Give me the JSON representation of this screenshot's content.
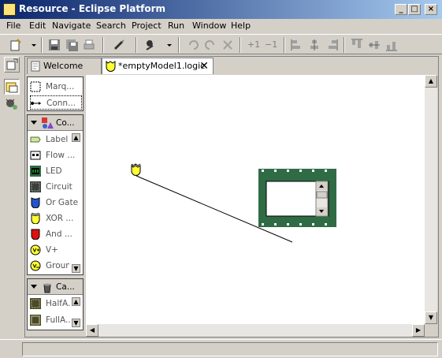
{
  "window": {
    "title": "Resource - Eclipse Platform"
  },
  "menu": [
    "File",
    "Edit",
    "Navigate",
    "Search",
    "Project",
    "Run",
    "Window",
    "Help"
  ],
  "toolbar": {
    "plus_one": "+1",
    "minus_one": "−1"
  },
  "tabs": [
    {
      "label": "Welcome"
    },
    {
      "label": "*emptyModel1.logic"
    }
  ],
  "palette": {
    "tools": [
      {
        "label": "Marq..."
      },
      {
        "label": "Conn..."
      }
    ],
    "components_header": "Co...",
    "components": [
      {
        "label": "Label",
        "icon": "label-icon"
      },
      {
        "label": "Flow ...",
        "icon": "flow-container-icon"
      },
      {
        "label": "LED",
        "icon": "led-icon"
      },
      {
        "label": "Circuit",
        "icon": "circuit-icon"
      },
      {
        "label": "Or Gate",
        "icon": "or-gate-icon"
      },
      {
        "label": "XOR ...",
        "icon": "xor-gate-icon"
      },
      {
        "label": "And ...",
        "icon": "and-gate-icon"
      },
      {
        "label": "V+",
        "icon": "vplus-icon"
      },
      {
        "label": "Ground",
        "icon": "ground-icon"
      }
    ],
    "canned_header": "Ca...",
    "canned": [
      {
        "label": "HalfA...",
        "icon": "half-adder-icon"
      },
      {
        "label": "FullA...",
        "icon": "full-adder-icon"
      }
    ]
  },
  "colors": {
    "titlebar_start": "#0a246a",
    "titlebar_end": "#a6caf0",
    "circuit_green": "#2f6b45",
    "gate_yellow": "#ffff33",
    "or_blue": "#2255cc",
    "and_red": "#dd1111"
  }
}
